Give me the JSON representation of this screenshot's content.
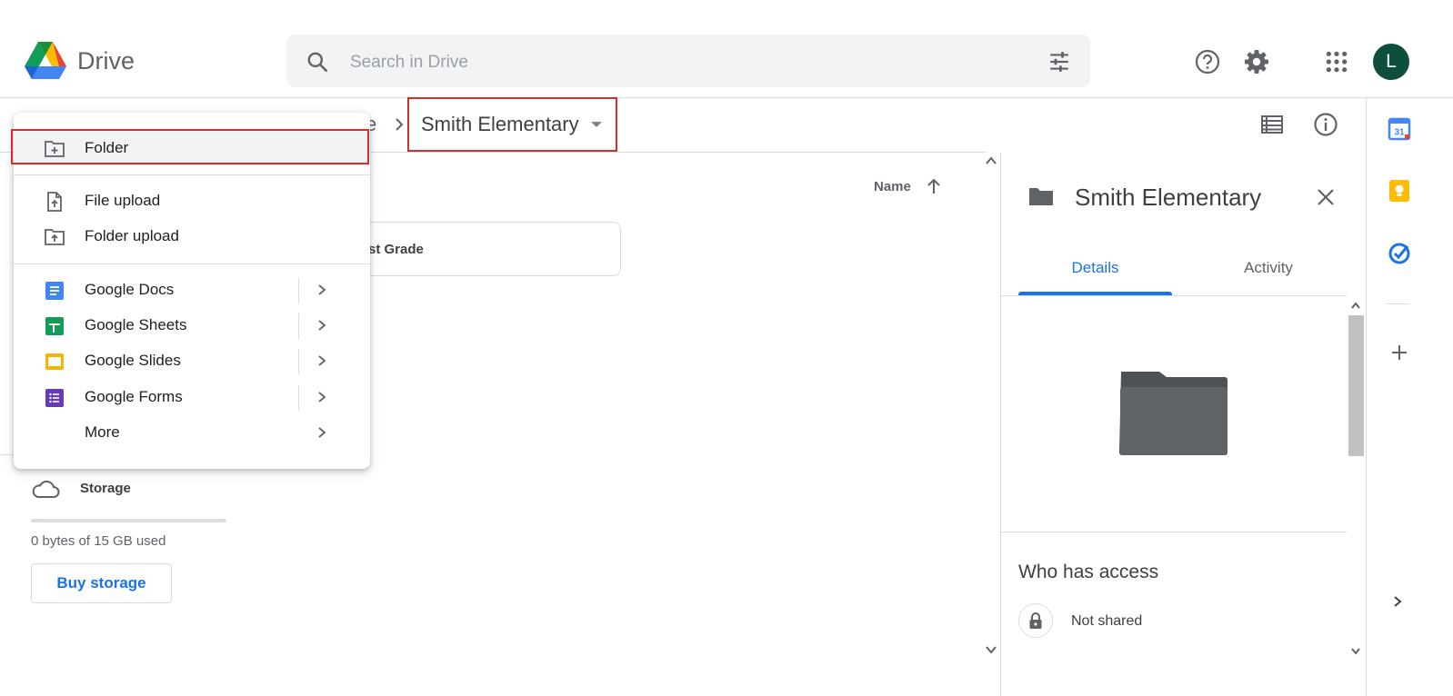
{
  "header": {
    "app_name": "Drive",
    "search_placeholder": "Search in Drive",
    "avatar_letter": "L"
  },
  "breadcrumb": {
    "truncated": "e",
    "current": "Smith Elementary"
  },
  "main": {
    "sort_label": "Name",
    "folder_card": "st Grade"
  },
  "new_menu": {
    "folder": "Folder",
    "file_upload": "File upload",
    "folder_upload": "Folder upload",
    "docs": "Google Docs",
    "sheets": "Google Sheets",
    "slides": "Google Slides",
    "forms": "Google Forms",
    "more": "More"
  },
  "storage": {
    "label": "Storage",
    "usage": "0 bytes of 15 GB used",
    "used_fraction": 0,
    "buy": "Buy storage"
  },
  "details": {
    "title": "Smith Elementary",
    "tabs": [
      "Details",
      "Activity"
    ],
    "who_access": "Who has access",
    "sharing": "Not shared"
  },
  "right_rail": {
    "calendar_day": "31"
  },
  "colors": {
    "accent": "#1a73e8",
    "highlight_border": "#d32f2f",
    "avatar_bg": "#0d4f3c",
    "docs": "#4285f4",
    "sheets": "#0f9d58",
    "slides": "#f4b400",
    "forms": "#673ab7"
  }
}
